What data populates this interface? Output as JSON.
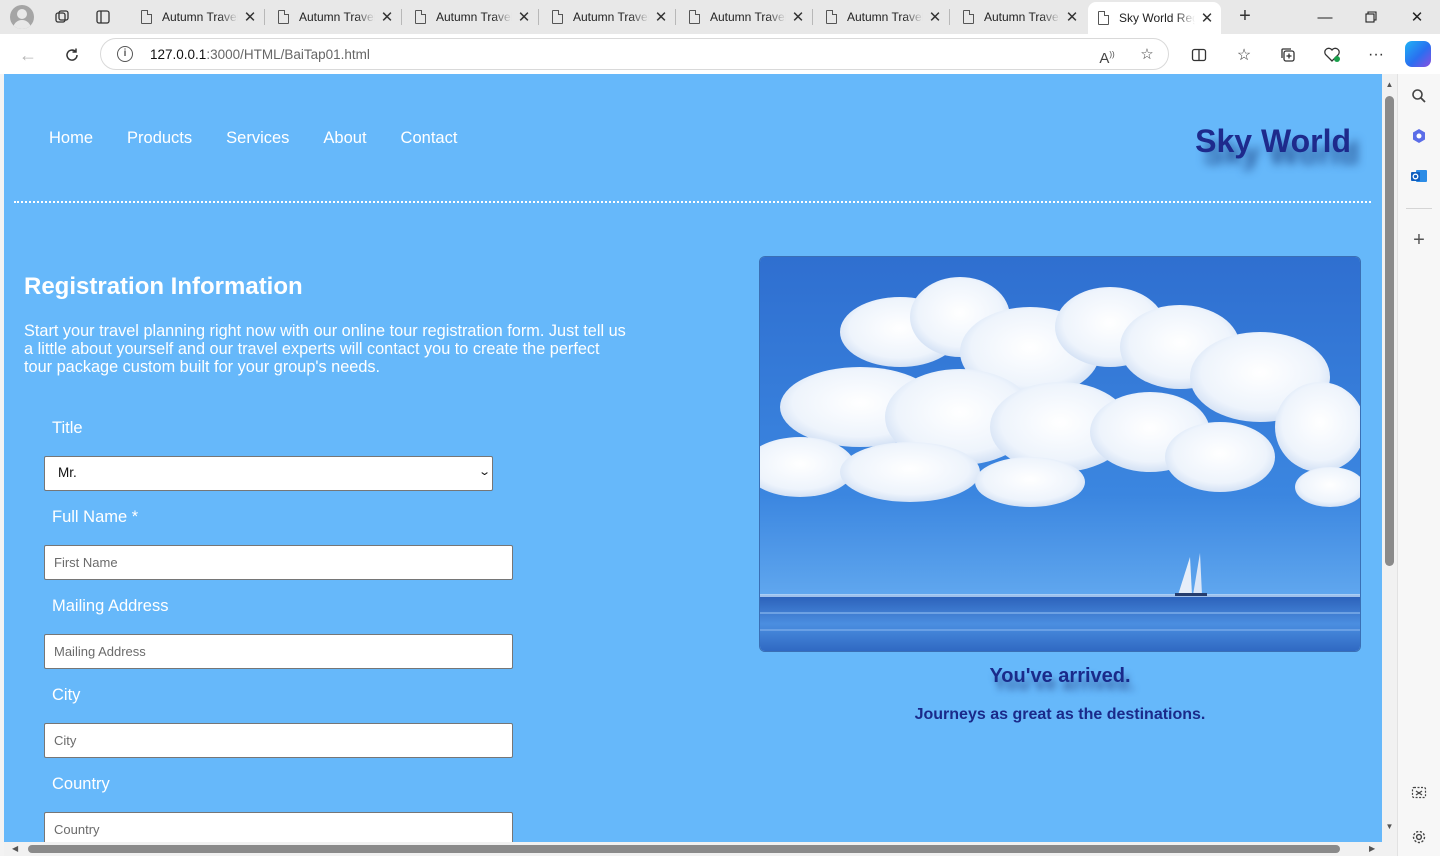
{
  "browser": {
    "tabs": [
      {
        "label": "Autumn Travel"
      },
      {
        "label": "Autumn Travel"
      },
      {
        "label": "Autumn Travel"
      },
      {
        "label": "Autumn Travel"
      },
      {
        "label": "Autumn Travel"
      },
      {
        "label": "Autumn Travel"
      },
      {
        "label": "Autumn Travel"
      },
      {
        "label": "Sky World Registration"
      }
    ],
    "url_host": "127.0.0.1",
    "url_rest": ":3000/HTML/BaiTap01.html"
  },
  "page": {
    "nav": [
      "Home",
      "Products",
      "Services",
      "About",
      "Contact"
    ],
    "brand": "Sky World",
    "heading": "Registration Information",
    "description": "Start your travel planning right now with our online tour registration form. Just tell us a little about yourself and our travel experts will contact you to create the perfect tour package custom built for your group's needs.",
    "form": {
      "title_label": "Title",
      "title_value": "Mr.",
      "fullname_label": "Full Name *",
      "fullname_placeholder": "First Name",
      "address_label": "Mailing Address",
      "address_placeholder": "Mailing Address",
      "city_label": "City",
      "city_placeholder": "City",
      "country_label": "Country",
      "country_placeholder": "Country"
    },
    "tagline": "You've arrived.",
    "subtagline": "Journeys as great as the destinations."
  }
}
